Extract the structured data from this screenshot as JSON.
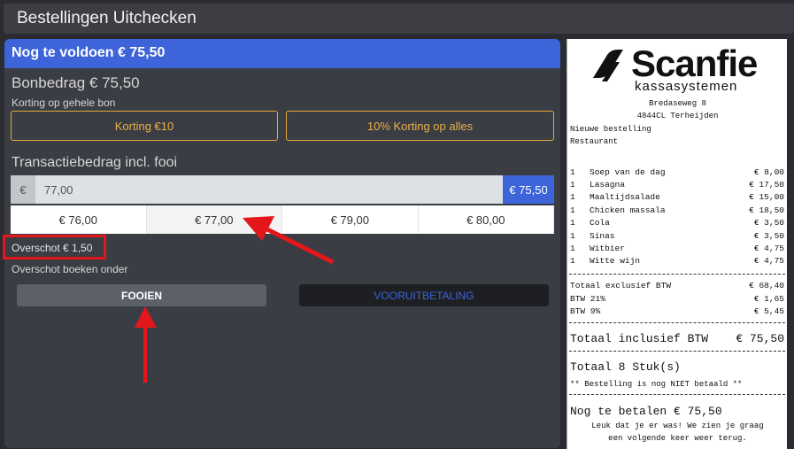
{
  "window": {
    "title": "Bestellingen Uitchecken"
  },
  "checkout": {
    "due_label": "Nog te voldoen € 75,50",
    "bill_amount": "Bonbedrag € 75,50",
    "discount_label": "Korting op gehele bon",
    "discount_buttons": [
      "Korting €10",
      "10% Korting op alles"
    ],
    "transaction_label": "Transactiebedrag incl. fooi",
    "currency_symbol": "€",
    "amount_value": "77,00",
    "due_chip": "€ 75,50",
    "quick_amounts": [
      "€ 76,00",
      "€ 77,00",
      "€ 79,00",
      "€ 80,00"
    ],
    "selected_quick_amount": "€ 77,00",
    "surplus": "Overschot € 1,50",
    "surplus_book_label": "Overschot boeken onder",
    "book_options": [
      "FOOIEN",
      "VOORUITBETALING"
    ],
    "selected_book_option": "FOOIEN"
  },
  "receipt": {
    "brand": "Scanfie",
    "brand_sub": "kassasystemen",
    "address_line1": "Bredaseweg 8",
    "address_line2": "4844CL Terheijden",
    "order_type": "Nieuwe bestelling",
    "location": "Restaurant",
    "items": [
      {
        "qty": "1",
        "name": "Soep van de dag",
        "price": "€ 8,00"
      },
      {
        "qty": "1",
        "name": "Lasagna",
        "price": "€ 17,50"
      },
      {
        "qty": "1",
        "name": "Maaltijdsalade",
        "price": "€ 15,00"
      },
      {
        "qty": "1",
        "name": "Chicken massala",
        "price": "€ 18,50"
      },
      {
        "qty": "1",
        "name": "Cola",
        "price": "€ 3,50"
      },
      {
        "qty": "1",
        "name": "Sinas",
        "price": "€ 3,50"
      },
      {
        "qty": "1",
        "name": "Witbier",
        "price": "€ 4,75"
      },
      {
        "qty": "1",
        "name": "Witte wijn",
        "price": "€ 4,75"
      }
    ],
    "total_ex_vat_label": "Totaal exclusief BTW",
    "total_ex_vat": "€ 68,40",
    "vat21_label": "BTW 21%",
    "vat21": "€ 1,65",
    "vat9_label": "BTW 9%",
    "vat9": "€ 5,45",
    "total_inc_label": "Totaal inclusief BTW",
    "total_inc": "€ 75,50",
    "total_items": "Totaal 8 Stuk(s)",
    "unpaid_note": "** Bestelling is nog NIET betaald **",
    "to_pay": "Nog te betalen € 75,50",
    "thanks_line1": "Leuk dat je er was! We zien je graag",
    "thanks_line2": "een volgende keer weer terug."
  },
  "colors": {
    "accent_blue": "#3d64d8",
    "discount_orange": "#e3a93a",
    "annotation_red": "#e3171b"
  }
}
